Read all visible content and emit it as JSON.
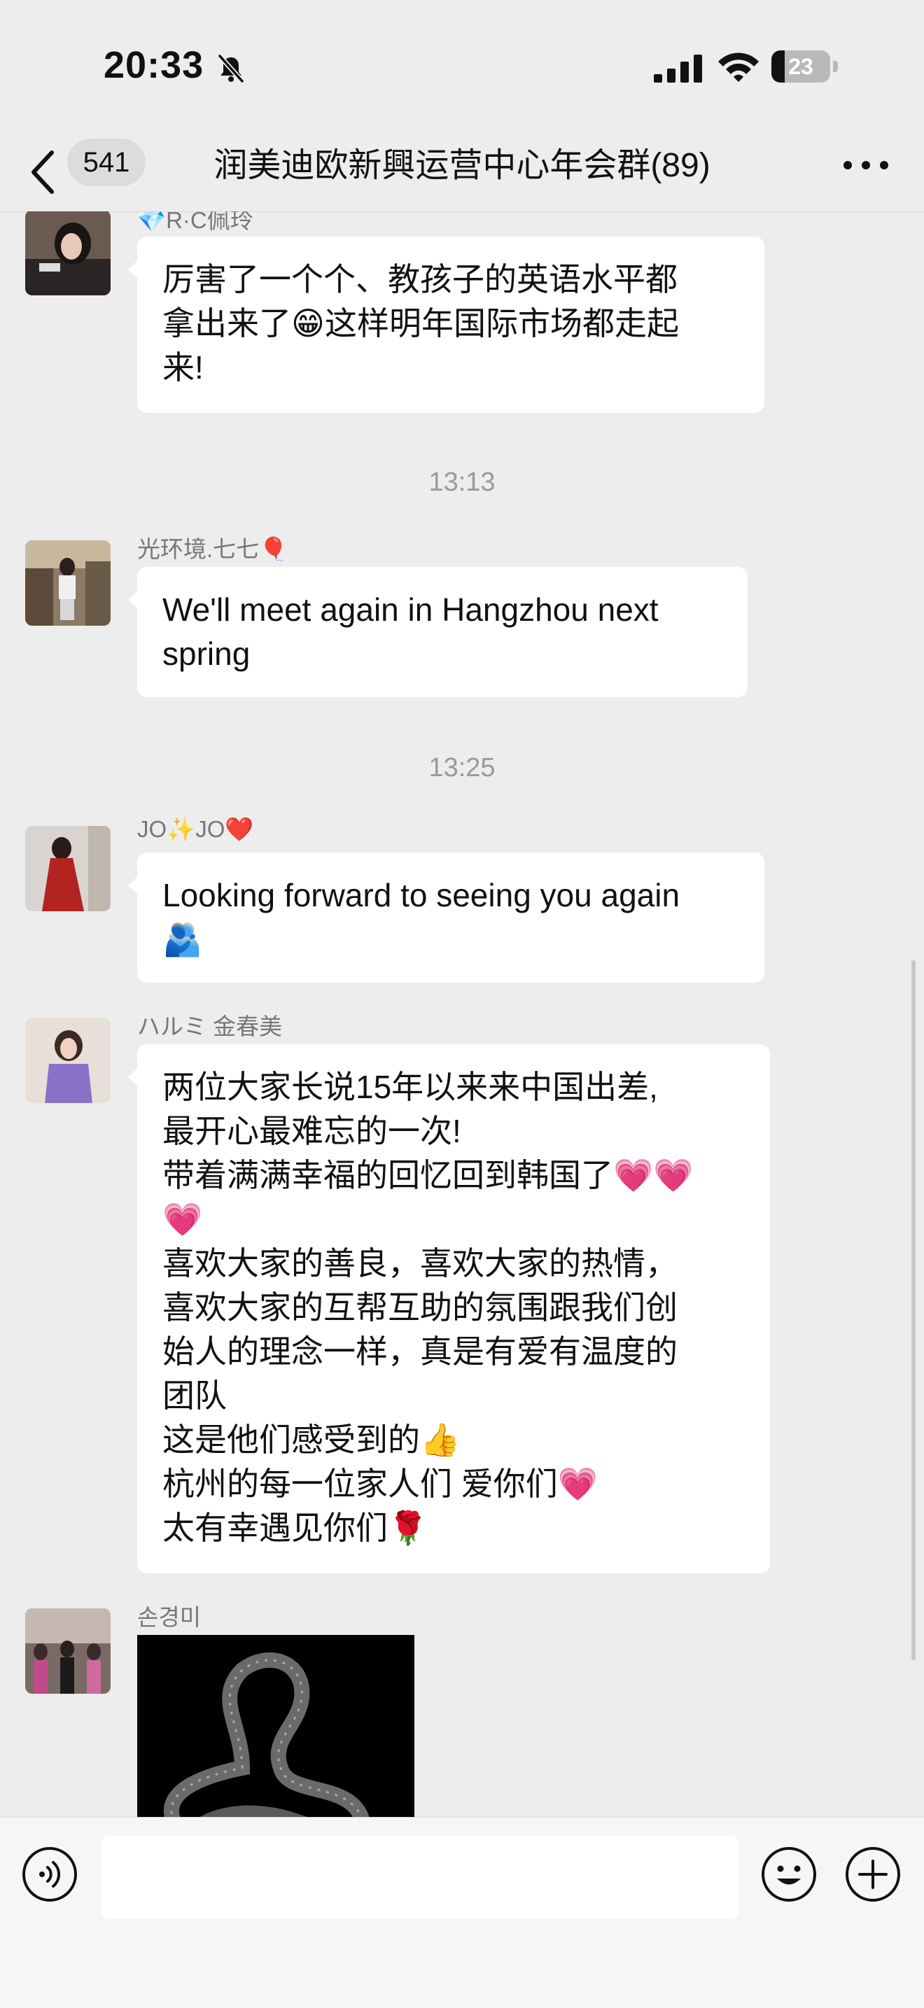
{
  "status_bar": {
    "time": "20:33",
    "battery_level": "23",
    "battery_fraction": 0.23
  },
  "nav": {
    "unread_count": "541",
    "title": "润美迪欧新興运营中心年会群(89)"
  },
  "messages": [
    {
      "sender": "💎R·C佩玲",
      "lines": [
        "厉害了一个个、教孩子的英语水平都",
        "拿出来了😁这样明年国际市场都走起",
        "来!"
      ]
    },
    {
      "timestamp": "13:13"
    },
    {
      "sender": "光环境.七七🎈",
      "lines": [
        "We'll meet again in Hangzhou next",
        "spring"
      ]
    },
    {
      "timestamp": "13:25"
    },
    {
      "sender": "JO✨JO❤️",
      "lines": [
        "Looking forward to seeing you again",
        "🫂"
      ]
    },
    {
      "sender": "ハルミ 金春美",
      "lines": [
        "两位大家长说15年以来来中国出差,",
        "最开心最难忘的一次!",
        "带着满满幸福的回忆回到韩国了💗💗",
        "💗",
        "喜欢大家的善良，喜欢大家的热情，",
        "喜欢大家的互帮互助的氛围跟我们创",
        "始人的理念一样，真是有爱有温度的",
        "团队",
        "这是他们感受到的👍",
        "杭州的每一位家人们 爱你们💗",
        "太有幸遇见你们🌹"
      ]
    },
    {
      "sender": "손경미",
      "image_description": "image"
    }
  ],
  "icons": {
    "back": "chevron-left-icon",
    "more": "more-dots-icon",
    "voice": "voice-icon",
    "emoji": "emoji-smile-icon",
    "plus": "plus-icon"
  },
  "colors": {
    "background": "#ededed",
    "bubble": "#ffffff",
    "heart": "#f0466b"
  }
}
